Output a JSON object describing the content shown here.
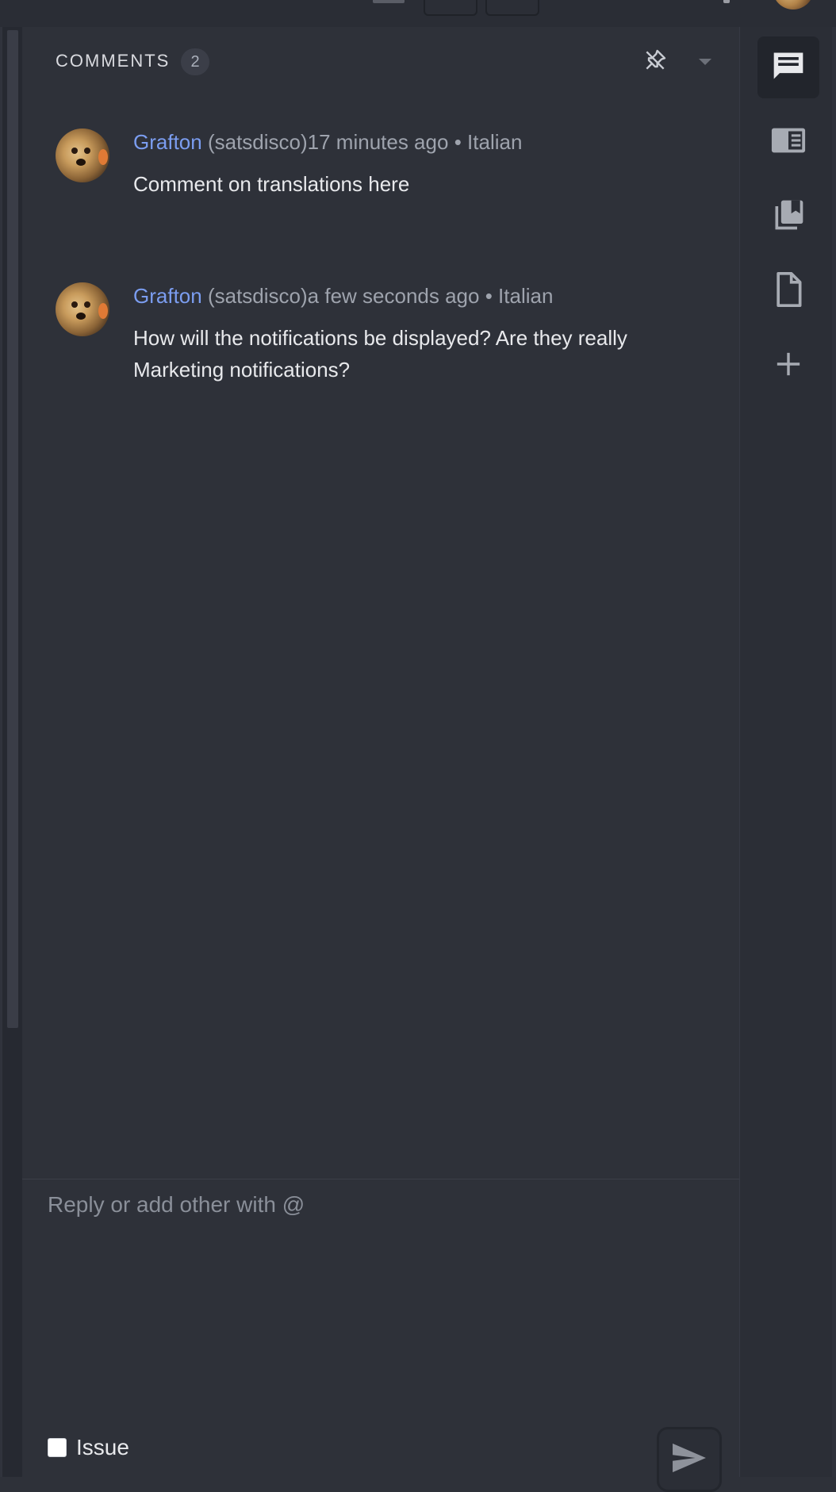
{
  "panel": {
    "title": "COMMENTS",
    "count": "2"
  },
  "comments": [
    {
      "author": "Grafton",
      "handle": "(satsdisco)",
      "time": "17 minutes ago",
      "separator": "•",
      "language": "Italian",
      "text": "Comment on translations here"
    },
    {
      "author": "Grafton",
      "handle": "(satsdisco)",
      "time": "a few seconds ago",
      "separator": "•",
      "language": "Italian",
      "text": "How will the notifications be displayed? Are they really Marketing notifications?"
    }
  ],
  "composer": {
    "placeholder": "Reply or add other with @",
    "issue_label": "Issue"
  },
  "sidebar": {
    "items": [
      {
        "icon": "comments-icon",
        "active": true
      },
      {
        "icon": "reader-panel-icon",
        "active": false
      },
      {
        "icon": "glossary-icon",
        "active": false
      },
      {
        "icon": "document-icon",
        "active": false
      },
      {
        "icon": "add-icon",
        "active": false
      }
    ]
  },
  "colors": {
    "background": "#2e3139",
    "author_link": "#7b9df0",
    "muted_text": "#9ea3ad"
  }
}
